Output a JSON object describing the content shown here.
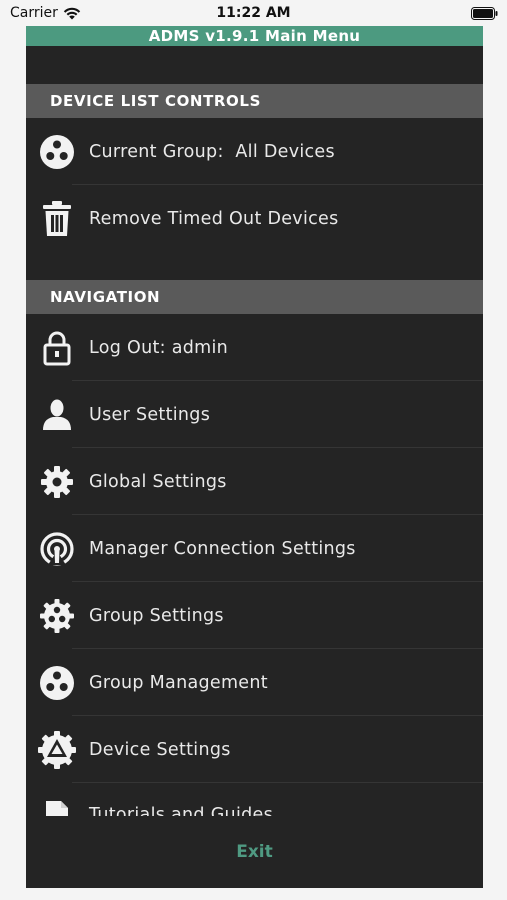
{
  "status_bar": {
    "carrier": "Carrier",
    "time": "11:22 AM",
    "wifi_icon": "wifi-icon",
    "battery_icon": "battery-icon"
  },
  "app": {
    "title": "ADMS v1.9.1 Main Menu",
    "accent_color": "#4c9a80"
  },
  "device_list_controls": {
    "header": "DEVICE LIST CONTROLS",
    "items": [
      {
        "label": "Current Group:  All Devices",
        "icon": "group-icon"
      },
      {
        "label": "Remove Timed Out Devices",
        "icon": "trash-icon"
      }
    ]
  },
  "navigation": {
    "header": "NAVIGATION",
    "items": [
      {
        "label": "Log Out: admin",
        "icon": "lock-icon"
      },
      {
        "label": "User Settings",
        "icon": "user-icon"
      },
      {
        "label": "Global Settings",
        "icon": "gear-icon"
      },
      {
        "label": "Manager Connection Settings",
        "icon": "broadcast-icon"
      },
      {
        "label": "Group Settings",
        "icon": "group-gear-icon"
      },
      {
        "label": "Group Management",
        "icon": "group-icon"
      },
      {
        "label": "Device Settings",
        "icon": "device-gear-icon"
      },
      {
        "label": "Tutorials and Guides",
        "icon": "document-icon"
      }
    ]
  },
  "footer": {
    "exit_label": "Exit"
  }
}
